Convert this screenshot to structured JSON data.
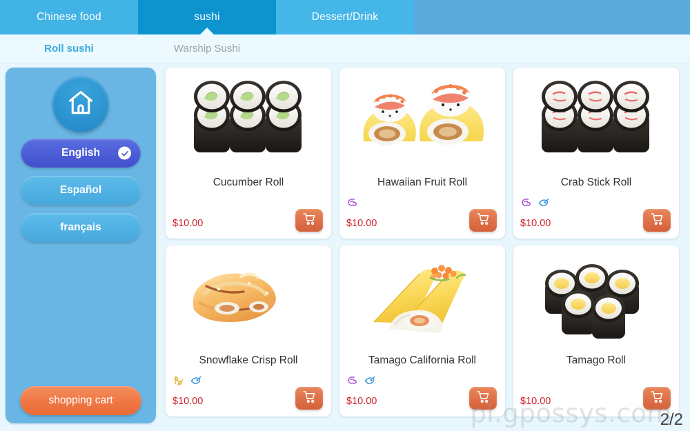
{
  "header": {
    "tabs": [
      {
        "label": "Chinese food",
        "active": false
      },
      {
        "label": "sushi",
        "active": true
      },
      {
        "label": "Dessert/Drink",
        "active": false
      }
    ],
    "subtabs": [
      {
        "label": "Roll sushi",
        "active": true
      },
      {
        "label": "Warship Sushi",
        "active": false
      }
    ]
  },
  "sidebar": {
    "home_icon": "home-icon",
    "languages": [
      {
        "label": "English",
        "selected": true
      },
      {
        "label": "Español",
        "selected": false
      },
      {
        "label": "français",
        "selected": false
      }
    ],
    "cart_label": "shopping cart"
  },
  "products": [
    {
      "name": "Cucumber Roll",
      "price": "$10.00",
      "image": "cucumber-roll-photo",
      "tags": [],
      "add_icon": "shopping-cart-icon"
    },
    {
      "name": "Hawaiian Fruit Roll",
      "price": "$10.00",
      "image": "hawaiian-fruit-roll-photo",
      "tags": [
        "squid-allergen-icon"
      ],
      "add_icon": "shopping-cart-icon"
    },
    {
      "name": "Crab Stick Roll",
      "price": "$10.00",
      "image": "crab-stick-roll-photo",
      "tags": [
        "squid-allergen-icon",
        "fish-allergen-icon"
      ],
      "add_icon": "shopping-cart-icon"
    },
    {
      "name": "Snowflake Crisp Roll",
      "price": "$10.00",
      "image": "snowflake-crisp-roll-photo",
      "tags": [
        "peanut-allergen-icon",
        "fish-allergen-icon"
      ],
      "add_icon": "shopping-cart-icon"
    },
    {
      "name": "Tamago California Roll",
      "price": "$10.00",
      "image": "tamago-california-roll-photo",
      "tags": [
        "squid-allergen-icon",
        "fish-allergen-icon"
      ],
      "add_icon": "shopping-cart-icon"
    },
    {
      "name": "Tamago Roll",
      "price": "$10.00",
      "image": "tamago-roll-photo",
      "tags": [],
      "add_icon": "shopping-cart-icon"
    }
  ],
  "footer": {
    "watermark": "pl.gpossys.com",
    "page_indicator": "2/2"
  },
  "colors": {
    "tab_active": "#0d94cf",
    "tab_inactive": "#42b3e5",
    "subtab_active": "#3aa8dd",
    "sidebar_bg": "#69b6e4",
    "language_selected": "#4a5ad6",
    "cart_orange": "#ef7744",
    "price_red": "#d0212a"
  }
}
